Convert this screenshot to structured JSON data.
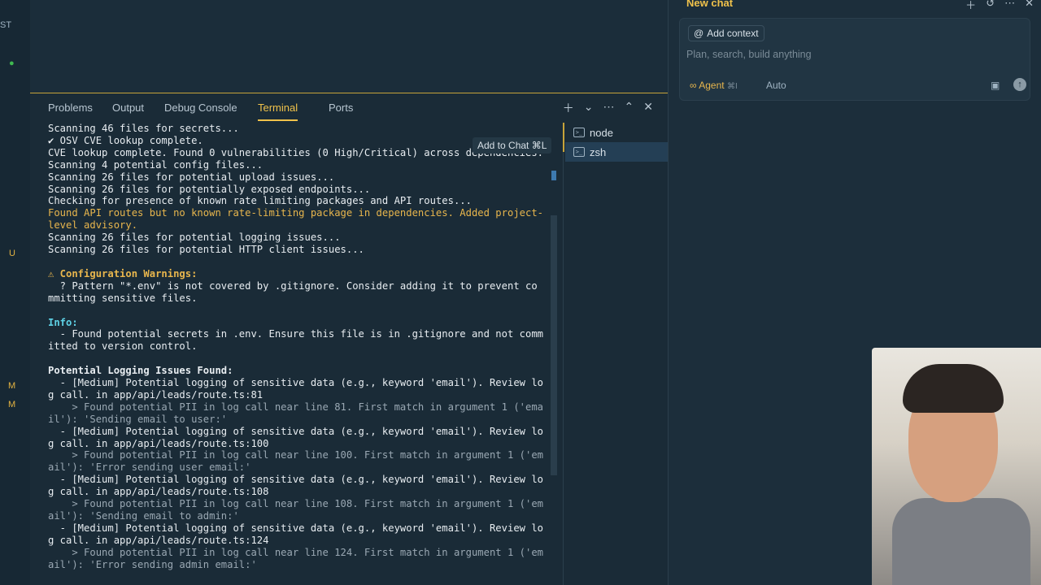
{
  "panel": {
    "tabs": [
      "Problems",
      "Output",
      "Debug Console",
      "Terminal",
      "Ports"
    ],
    "active_tab": "Terminal",
    "tooltip": "Add to Chat ⌘L",
    "terminals": [
      "node",
      "zsh"
    ],
    "active_terminal": "zsh"
  },
  "terminal_lines": [
    "Scanning 46 files for secrets...",
    "✔ OSV CVE lookup complete.",
    "CVE lookup complete. Found 0 vulnerabilities (0 High/Critical) across dependencies.",
    "Scanning 4 potential config files...",
    "Scanning 26 files for potential upload issues...",
    "Scanning 26 files for potentially exposed endpoints...",
    "Checking for presence of known rate limiting packages and API routes...",
    "Found API routes but no known rate-limiting package in dependencies. Added project-",
    "level advisory.",
    "Scanning 26 files for potential logging issues...",
    "Scanning 26 files for potential HTTP client issues...",
    "",
    "⚠ Configuration Warnings:",
    "  ? Pattern \"*.env\" is not covered by .gitignore. Consider adding it to prevent co",
    "mmitting sensitive files.",
    "",
    "Info:",
    "  - Found potential secrets in .env. Ensure this file is in .gitignore and not comm",
    "itted to version control.",
    "",
    "Potential Logging Issues Found:",
    "  - [Medium] Potential logging of sensitive data (e.g., keyword 'email'). Review lo",
    "g call. in app/api/leads/route.ts:81",
    "    > Found potential PII in log call near line 81. First match in argument 1 ('ema",
    "il'): 'Sending email to user:'",
    "  - [Medium] Potential logging of sensitive data (e.g., keyword 'email'). Review lo",
    "g call. in app/api/leads/route.ts:100",
    "    > Found potential PII in log call near line 100. First match in argument 1 ('em",
    "ail'): 'Error sending user email:'",
    "  - [Medium] Potential logging of sensitive data (e.g., keyword 'email'). Review lo",
    "g call. in app/api/leads/route.ts:108",
    "    > Found potential PII in log call near line 108. First match in argument 1 ('em",
    "ail'): 'Sending email to admin:'",
    "  - [Medium] Potential logging of sensitive data (e.g., keyword 'email'). Review lo",
    "g call. in app/api/leads/route.ts:124",
    "    > Found potential PII in log call near line 124. First match in argument 1 ('em",
    "ail'): 'Error sending admin email:'"
  ],
  "chat": {
    "title": "New chat",
    "add_context": "Add context",
    "placeholder": "Plan, search, build anything",
    "agent_label": "Agent",
    "agent_shortcut": "⌘I",
    "mode": "Auto"
  }
}
